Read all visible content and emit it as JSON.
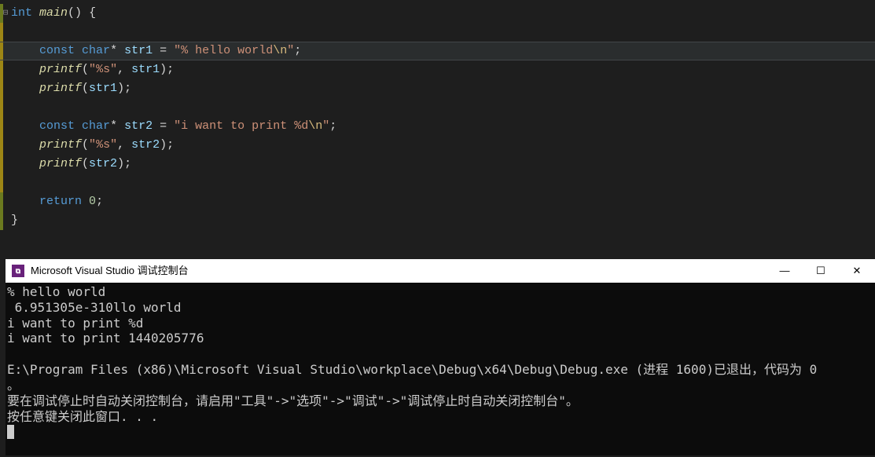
{
  "editor": {
    "fold_icon": "⊟",
    "lines": [
      {
        "indent": "",
        "change": "saved",
        "fold": true,
        "tokens": [
          {
            "t": "kw-type",
            "v": "int"
          },
          {
            "t": "plain",
            "v": " "
          },
          {
            "t": "fn-name italic",
            "v": "main"
          },
          {
            "t": "paren",
            "v": "()"
          },
          {
            "t": "plain",
            "v": " "
          },
          {
            "t": "brace",
            "v": "{"
          }
        ]
      },
      {
        "indent": "",
        "change": "unsaved",
        "blank": true
      },
      {
        "indent": "    ",
        "change": "unsaved",
        "highlighted": true,
        "tokens": [
          {
            "t": "kw-modifier",
            "v": "const"
          },
          {
            "t": "plain",
            "v": " "
          },
          {
            "t": "kw-type",
            "v": "char"
          },
          {
            "t": "operator",
            "v": "*"
          },
          {
            "t": "plain",
            "v": " "
          },
          {
            "t": "variable",
            "v": "str1"
          },
          {
            "t": "plain",
            "v": " "
          },
          {
            "t": "operator",
            "v": "="
          },
          {
            "t": "plain",
            "v": " "
          },
          {
            "t": "string-quote",
            "v": "\""
          },
          {
            "t": "string-text",
            "v": "% hello world"
          },
          {
            "t": "escape",
            "v": "\\n"
          },
          {
            "t": "string-quote",
            "v": "\""
          },
          {
            "t": "punct",
            "v": ";"
          }
        ]
      },
      {
        "indent": "    ",
        "change": "unsaved",
        "tokens": [
          {
            "t": "fn-name italic",
            "v": "printf"
          },
          {
            "t": "paren",
            "v": "("
          },
          {
            "t": "string-quote",
            "v": "\""
          },
          {
            "t": "string-text",
            "v": "%s"
          },
          {
            "t": "string-quote",
            "v": "\""
          },
          {
            "t": "punct",
            "v": ", "
          },
          {
            "t": "variable",
            "v": "str1"
          },
          {
            "t": "paren",
            "v": ")"
          },
          {
            "t": "punct",
            "v": ";"
          }
        ]
      },
      {
        "indent": "    ",
        "change": "unsaved",
        "tokens": [
          {
            "t": "fn-name italic",
            "v": "printf"
          },
          {
            "t": "paren",
            "v": "("
          },
          {
            "t": "variable",
            "v": "str1"
          },
          {
            "t": "paren",
            "v": ")"
          },
          {
            "t": "punct",
            "v": ";"
          }
        ]
      },
      {
        "indent": "",
        "change": "unsaved",
        "blank": true
      },
      {
        "indent": "    ",
        "change": "unsaved",
        "tokens": [
          {
            "t": "kw-modifier",
            "v": "const"
          },
          {
            "t": "plain",
            "v": " "
          },
          {
            "t": "kw-type",
            "v": "char"
          },
          {
            "t": "operator",
            "v": "*"
          },
          {
            "t": "plain",
            "v": " "
          },
          {
            "t": "variable",
            "v": "str2"
          },
          {
            "t": "plain",
            "v": " "
          },
          {
            "t": "operator",
            "v": "="
          },
          {
            "t": "plain",
            "v": " "
          },
          {
            "t": "string-quote",
            "v": "\""
          },
          {
            "t": "string-text",
            "v": "i want to print %d"
          },
          {
            "t": "escape",
            "v": "\\n"
          },
          {
            "t": "string-quote",
            "v": "\""
          },
          {
            "t": "punct",
            "v": ";"
          }
        ]
      },
      {
        "indent": "    ",
        "change": "unsaved",
        "tokens": [
          {
            "t": "fn-name italic",
            "v": "printf"
          },
          {
            "t": "paren",
            "v": "("
          },
          {
            "t": "string-quote",
            "v": "\""
          },
          {
            "t": "string-text",
            "v": "%s"
          },
          {
            "t": "string-quote",
            "v": "\""
          },
          {
            "t": "punct",
            "v": ", "
          },
          {
            "t": "variable",
            "v": "str2"
          },
          {
            "t": "paren",
            "v": ")"
          },
          {
            "t": "punct",
            "v": ";"
          }
        ]
      },
      {
        "indent": "    ",
        "change": "unsaved",
        "tokens": [
          {
            "t": "fn-name italic",
            "v": "printf"
          },
          {
            "t": "paren",
            "v": "("
          },
          {
            "t": "variable",
            "v": "str2"
          },
          {
            "t": "paren",
            "v": ")"
          },
          {
            "t": "punct",
            "v": ";"
          }
        ]
      },
      {
        "indent": "",
        "change": "unsaved",
        "blank": true
      },
      {
        "indent": "    ",
        "change": "saved",
        "tokens": [
          {
            "t": "kw-modifier",
            "v": "return"
          },
          {
            "t": "plain",
            "v": " "
          },
          {
            "t": "number",
            "v": "0"
          },
          {
            "t": "punct",
            "v": ";"
          }
        ]
      },
      {
        "indent": "",
        "change": "saved",
        "tokens": [
          {
            "t": "brace",
            "v": "}"
          }
        ]
      }
    ]
  },
  "console": {
    "icon_text": "⧉",
    "title": "Microsoft Visual Studio 调试控制台",
    "output_lines": [
      "% hello world",
      " 6.951305e-310llo world",
      "i want to print %d",
      "i want to print 1440205776",
      "",
      "E:\\Program Files (x86)\\Microsoft Visual Studio\\workplace\\Debug\\x64\\Debug\\Debug.exe (进程 1600)已退出，代码为 0",
      "。",
      "要在调试停止时自动关闭控制台，请启用\"工具\"->\"选项\"->\"调试\"->\"调试停止时自动关闭控制台\"。",
      "按任意键关闭此窗口. . ."
    ],
    "controls": {
      "minimize": "—",
      "maximize": "☐",
      "close": "✕"
    }
  }
}
